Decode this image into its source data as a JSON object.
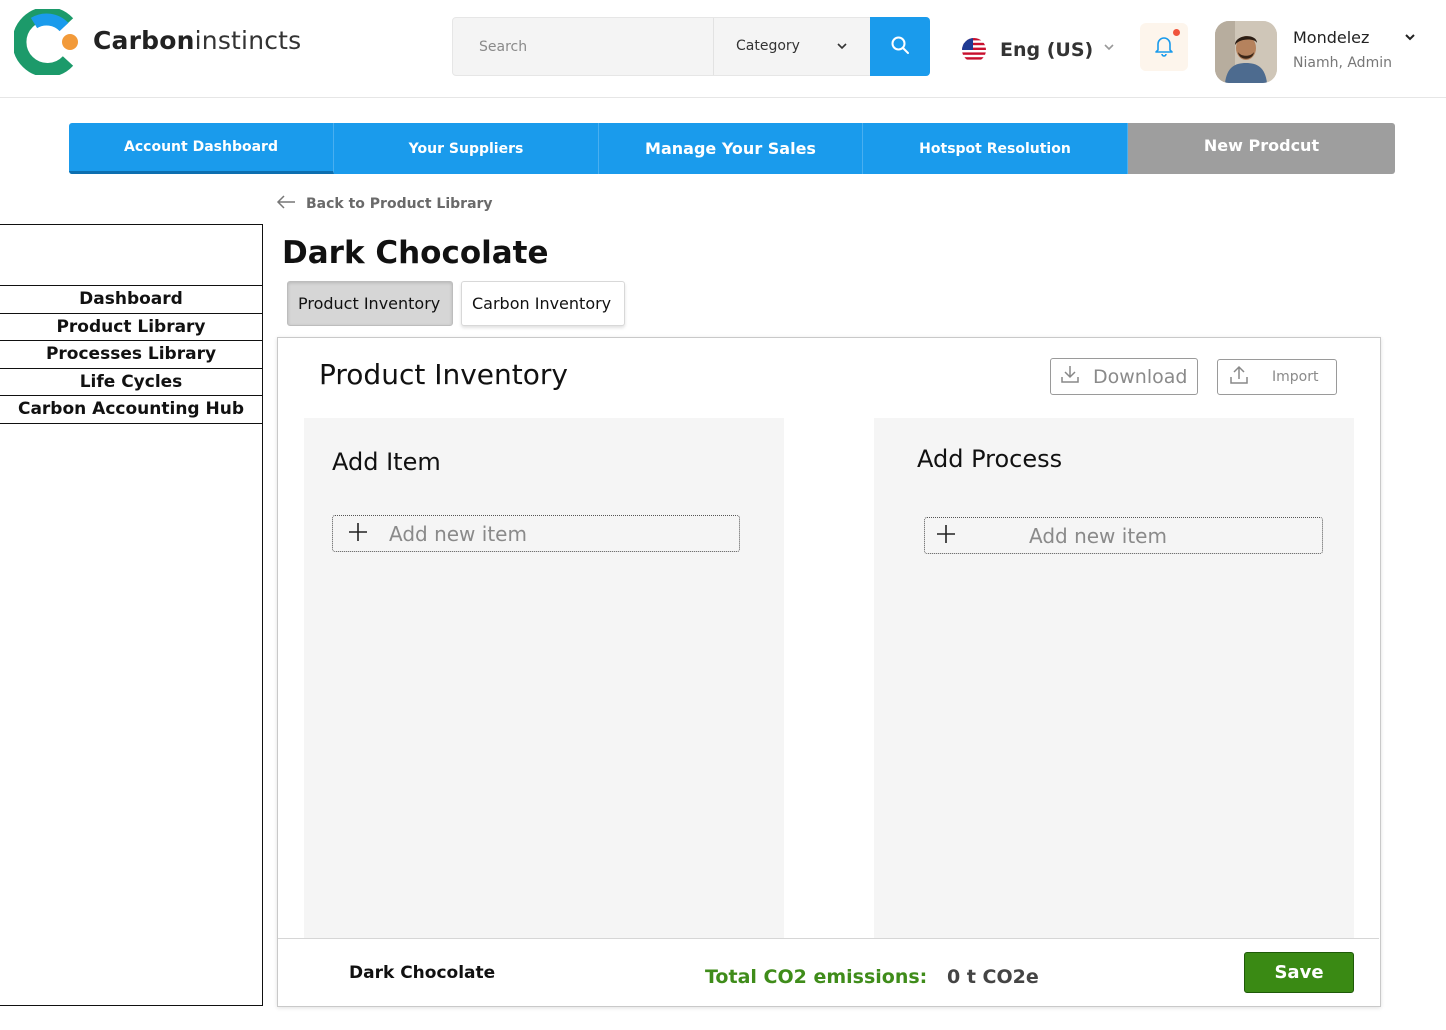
{
  "brand": {
    "name_bold": "Carbon",
    "name_light": "instincts"
  },
  "search": {
    "placeholder": "Search",
    "category_label": "Category"
  },
  "language": {
    "label": "Eng (US)"
  },
  "user": {
    "name": "Mondelez",
    "role": "Niamh, Admin"
  },
  "topnav": {
    "tabs": [
      {
        "label": "Account Dashboard"
      },
      {
        "label": "Your Suppliers"
      },
      {
        "label": "Manage Your Sales"
      },
      {
        "label": "Hotspot Resolution"
      },
      {
        "label": "New Prodcut"
      }
    ]
  },
  "back_link": {
    "label": "Back to Product Library"
  },
  "sidebar": {
    "items": [
      {
        "label": "Dashboard"
      },
      {
        "label": "Product Library"
      },
      {
        "label": "Processes Library"
      },
      {
        "label": "Life Cycles"
      },
      {
        "label": "Carbon Accounting Hub"
      }
    ]
  },
  "page": {
    "title": "Dark Chocolate",
    "subtabs": [
      {
        "label": "Product Inventory"
      },
      {
        "label": "Carbon Inventory"
      }
    ]
  },
  "panel": {
    "title": "Product Inventory",
    "download_label": "Download",
    "import_label": "Import",
    "add_item": {
      "title": "Add Item",
      "row_label": "Add new item"
    },
    "add_process": {
      "title": "Add Process",
      "row_label": "Add new item"
    },
    "footer": {
      "product_name": "Dark Chocolate",
      "total_label": "Total CO2 emissions:",
      "total_value": "0 t CO2e",
      "save_label": "Save"
    }
  },
  "colors": {
    "primary": "#1a9bec",
    "inactive_tab": "#9e9e9e",
    "save_button": "#3a8a14",
    "emissions_label": "#3f8c1a"
  }
}
